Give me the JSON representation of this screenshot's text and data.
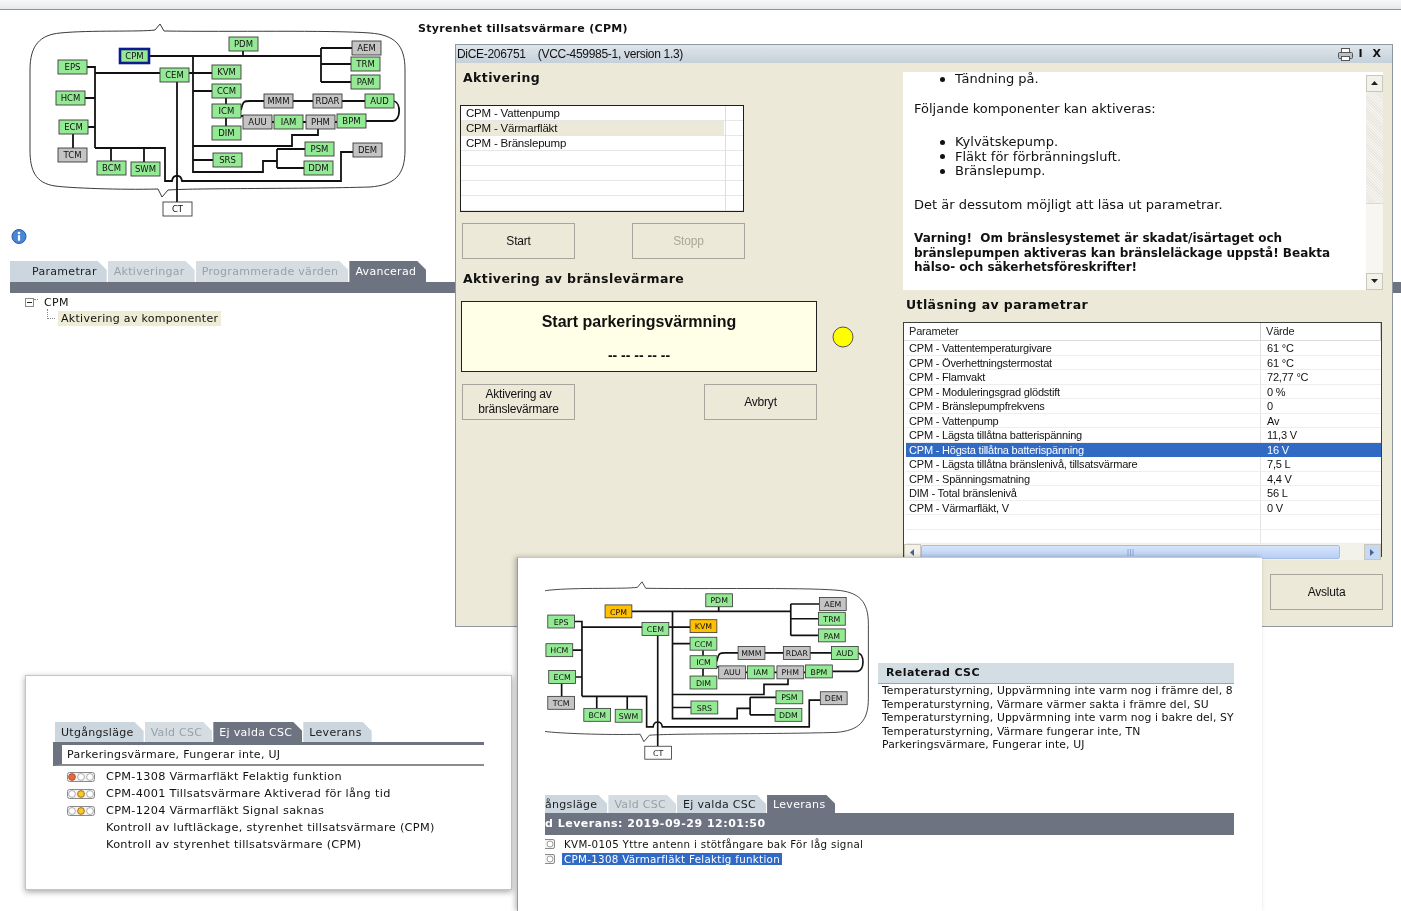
{
  "page_title": "Styrenhet tillsatsvärmare (CPM)",
  "network_diagram": {
    "nodes": [
      {
        "label": "PDM",
        "color": "#94ea94",
        "selected": false
      },
      {
        "label": "AEM",
        "color": "#c4c4c4",
        "selected": false
      },
      {
        "label": "CPM",
        "color": "#94ea94",
        "selected": true
      },
      {
        "label": "TRM",
        "color": "#94ea94",
        "selected": false
      },
      {
        "label": "EPS",
        "color": "#94ea94",
        "selected": false
      },
      {
        "label": "KVM",
        "color": "#94ea94",
        "selected": false
      },
      {
        "label": "CEM",
        "color": "#94ea94",
        "selected": false
      },
      {
        "label": "PAM",
        "color": "#94ea94",
        "selected": false
      },
      {
        "label": "HCM",
        "color": "#94ea94",
        "selected": false
      },
      {
        "label": "CCM",
        "color": "#94ea94",
        "selected": false
      },
      {
        "label": "MMM",
        "color": "#c4c4c4",
        "selected": false
      },
      {
        "label": "RDAR",
        "color": "#c4c4c4",
        "selected": false
      },
      {
        "label": "AUD",
        "color": "#94ea94",
        "selected": false
      },
      {
        "label": "ICM",
        "color": "#94ea94",
        "selected": false
      },
      {
        "label": "AUU",
        "color": "#c4c4c4",
        "selected": false
      },
      {
        "label": "IAM",
        "color": "#94ea94",
        "selected": false
      },
      {
        "label": "PHM",
        "color": "#c4c4c4",
        "selected": false
      },
      {
        "label": "BPM",
        "color": "#94ea94",
        "selected": false
      },
      {
        "label": "ECM",
        "color": "#94ea94",
        "selected": false
      },
      {
        "label": "DIM",
        "color": "#94ea94",
        "selected": false
      },
      {
        "label": "PSM",
        "color": "#94ea94",
        "selected": false
      },
      {
        "label": "DEM",
        "color": "#c4c4c4",
        "selected": false
      },
      {
        "label": "TCM",
        "color": "#c4c4c4",
        "selected": false
      },
      {
        "label": "SRS",
        "color": "#94ea94",
        "selected": false
      },
      {
        "label": "BCM",
        "color": "#94ea94",
        "selected": false
      },
      {
        "label": "SWM",
        "color": "#94ea94",
        "selected": false
      },
      {
        "label": "DDM",
        "color": "#94ea94",
        "selected": false
      },
      {
        "label": "CT",
        "selected": false
      }
    ]
  },
  "tabs": [
    {
      "label": "Parametrar",
      "selected": false,
      "disabled": false
    },
    {
      "label": "Aktiveringar",
      "selected": false,
      "disabled": true
    },
    {
      "label": "Programmerade värden",
      "selected": false,
      "disabled": true
    },
    {
      "label": "Avancerad",
      "selected": true,
      "disabled": false
    }
  ],
  "tree": [
    {
      "label": "CPM",
      "expanded": true,
      "selected": false,
      "children": [
        {
          "label": "Aktivering av komponenter",
          "selected": true
        }
      ]
    }
  ],
  "dialog": {
    "title": "DiCE-206751",
    "version": "(VCC-459985-1, version 1.3)",
    "title_buttons": [
      "I",
      "X"
    ],
    "activation": {
      "heading": "Aktivering",
      "items": [
        {
          "label": "CPM - Vattenpump",
          "selected": false
        },
        {
          "label": "CPM - Värmarfläkt",
          "selected": true
        },
        {
          "label": "CPM - Bränslepump",
          "selected": false
        }
      ],
      "buttons": [
        {
          "label": "Start",
          "disabled": false
        },
        {
          "label": "Stopp",
          "disabled": true
        }
      ]
    },
    "fuel_heater": {
      "heading": "Aktivering av bränslevärmare",
      "status_title": "Start parkeringsvärmning",
      "status_value": "-- -- -- -- --",
      "indicator_lit": true,
      "buttons": [
        {
          "label": "Aktivering av bränslevärmare",
          "disabled": false
        },
        {
          "label": "Avbryt",
          "disabled": false
        }
      ]
    },
    "help": {
      "blocks": [
        {
          "kind": "bullets",
          "items": [
            "Tändning på."
          ]
        },
        {
          "kind": "paragraph",
          "text": "Följande komponenter kan aktiveras:"
        },
        {
          "kind": "bullets",
          "items": [
            "Kylvätskepump.",
            "Fläkt för förbränningsluft.",
            "Bränslepump."
          ]
        },
        {
          "kind": "paragraph",
          "text": "Det är dessutom möjligt att läsa ut parametrar."
        },
        {
          "kind": "warning",
          "text": "Varning!  Om bränslesystemet är skadat/isärtaget och bränslepumpen aktiveras kan bränsleläckage uppstå! Beakta hälso- och säkerhetsföreskrifter!"
        }
      ]
    },
    "parameters": {
      "heading": "Utläsning av parametrar",
      "columns": [
        "Parameter",
        "Värde"
      ],
      "rows": [
        {
          "parameter": "CPM - Vattentemperaturgivare",
          "value": "61 °C",
          "selected": false
        },
        {
          "parameter": "CPM - Överhettningstermostat",
          "value": "61 °C",
          "selected": false
        },
        {
          "parameter": "CPM - Flamvakt",
          "value": "72,77 °C",
          "selected": false
        },
        {
          "parameter": "CPM - Moduleringsgrad glödstift",
          "value": "0 %",
          "selected": false
        },
        {
          "parameter": "CPM - Bränslepumpfrekvens",
          "value": "0",
          "selected": false
        },
        {
          "parameter": "CPM - Vattenpump",
          "value": "Av",
          "selected": false
        },
        {
          "parameter": "CPM - Lägsta tillåtna batterispänning",
          "value": "11,3 V",
          "selected": false
        },
        {
          "parameter": "CPM - Högsta tillåtna batterispänning",
          "value": "16 V",
          "selected": true
        },
        {
          "parameter": "CPM - Lägsta tillåtna bränslenivå, tillsatsvärmare",
          "value": "7,5 L",
          "selected": false
        },
        {
          "parameter": "CPM - Spänningsmatning",
          "value": "4,4 V",
          "selected": false
        },
        {
          "parameter": "DIM - Total bränslenivå",
          "value": "56 L",
          "selected": false
        },
        {
          "parameter": "CPM - Värmarfläkt, V",
          "value": "0 V",
          "selected": false
        }
      ]
    },
    "close_button": "Avsluta"
  },
  "csc_panel": {
    "tabs": [
      {
        "label": "Utgångsläge",
        "selected": false,
        "disabled": false
      },
      {
        "label": "Vald CSC",
        "selected": false,
        "disabled": true
      },
      {
        "label": "Ej valda CSC",
        "selected": true,
        "disabled": false
      },
      {
        "label": "Leverans",
        "selected": false,
        "disabled": false
      }
    ],
    "complaint": "Parkeringsvärmare, Fungerar inte, UJ",
    "items": [
      {
        "kind": "fault",
        "lamps": [
          {
            "on": true
          },
          {
            "on": false
          },
          {
            "on": false
          }
        ],
        "text": "CPM-1308 Värmarfläkt Felaktig funktion"
      },
      {
        "kind": "fault",
        "lamps": [
          {
            "on": false
          },
          {
            "on": true
          },
          {
            "on": false
          }
        ],
        "text": "CPM-4001 Tillsatsvärmare Aktiverad för lång tid"
      },
      {
        "kind": "fault",
        "lamps": [
          {
            "on": false
          },
          {
            "on": true
          },
          {
            "on": false
          }
        ],
        "text": "CPM-1204 Värmarfläkt Signal saknas"
      },
      {
        "kind": "test",
        "text": "Kontroll av luftläckage, styrenhet tillsatsvärmare (CPM)"
      },
      {
        "kind": "test",
        "text": "Kontroll av styrenhet tillsatsvärmare (CPM)"
      }
    ]
  },
  "delivery_panel": {
    "diagram": {
      "nodes": [
        {
          "label": "PDM",
          "color": "#94ea94"
        },
        {
          "label": "AEM",
          "color": "#c4c4c4"
        },
        {
          "label": "CPM",
          "color": "#ffc000"
        },
        {
          "label": "TRM",
          "color": "#94ea94"
        },
        {
          "label": "EPS",
          "color": "#94ea94"
        },
        {
          "label": "KVM",
          "color": "#ffc000"
        },
        {
          "label": "CEM",
          "color": "#94ea94"
        },
        {
          "label": "PAM",
          "color": "#94ea94"
        },
        {
          "label": "HCM",
          "color": "#94ea94"
        },
        {
          "label": "CCM",
          "color": "#94ea94"
        },
        {
          "label": "MMM",
          "color": "#c4c4c4"
        },
        {
          "label": "RDAR",
          "color": "#c4c4c4"
        },
        {
          "label": "AUD",
          "color": "#94ea94"
        },
        {
          "label": "ICM",
          "color": "#94ea94"
        },
        {
          "label": "AUU",
          "color": "#c4c4c4"
        },
        {
          "label": "IAM",
          "color": "#94ea94"
        },
        {
          "label": "PHM",
          "color": "#c4c4c4"
        },
        {
          "label": "BPM",
          "color": "#94ea94"
        },
        {
          "label": "ECM",
          "color": "#94ea94"
        },
        {
          "label": "DIM",
          "color": "#94ea94"
        },
        {
          "label": "PSM",
          "color": "#94ea94"
        },
        {
          "label": "DEM",
          "color": "#c4c4c4"
        },
        {
          "label": "TCM",
          "color": "#c4c4c4"
        },
        {
          "label": "SRS",
          "color": "#94ea94"
        },
        {
          "label": "BCM",
          "color": "#94ea94"
        },
        {
          "label": "SWM",
          "color": "#94ea94"
        },
        {
          "label": "DDM",
          "color": "#94ea94"
        },
        {
          "label": "CT"
        }
      ]
    },
    "related_csc": {
      "heading": "Relaterad CSC",
      "items": [
        "Temperaturstyrning, Uppvärmning inte varm nog i främre del, 8",
        "Temperaturstyrning, Värmare värmer sakta i främre del, SU",
        "Temperaturstyrning, Uppvärmning inte varm nog i bakre del, SY",
        "Temperaturstyrning, Värmare fungerar inte, TN",
        "Parkeringsvärmare, Fungerar inte, UJ"
      ]
    },
    "tabs": [
      {
        "label": "ångsläge",
        "selected": false,
        "disabled": false
      },
      {
        "label": "Vald CSC",
        "selected": false,
        "disabled": true
      },
      {
        "label": "Ej valda CSC",
        "selected": false,
        "disabled": false
      },
      {
        "label": "Leverans",
        "selected": true,
        "disabled": false
      }
    ],
    "header": "d Leverans: 2019-09-29 12:01:50",
    "items": [
      {
        "text": "KVM-0105 Yttre antenn i stötfångare bak För låg signal",
        "selected": false
      },
      {
        "text": "CPM-1308 Värmarfläkt Felaktig funktion",
        "selected": true
      }
    ]
  }
}
